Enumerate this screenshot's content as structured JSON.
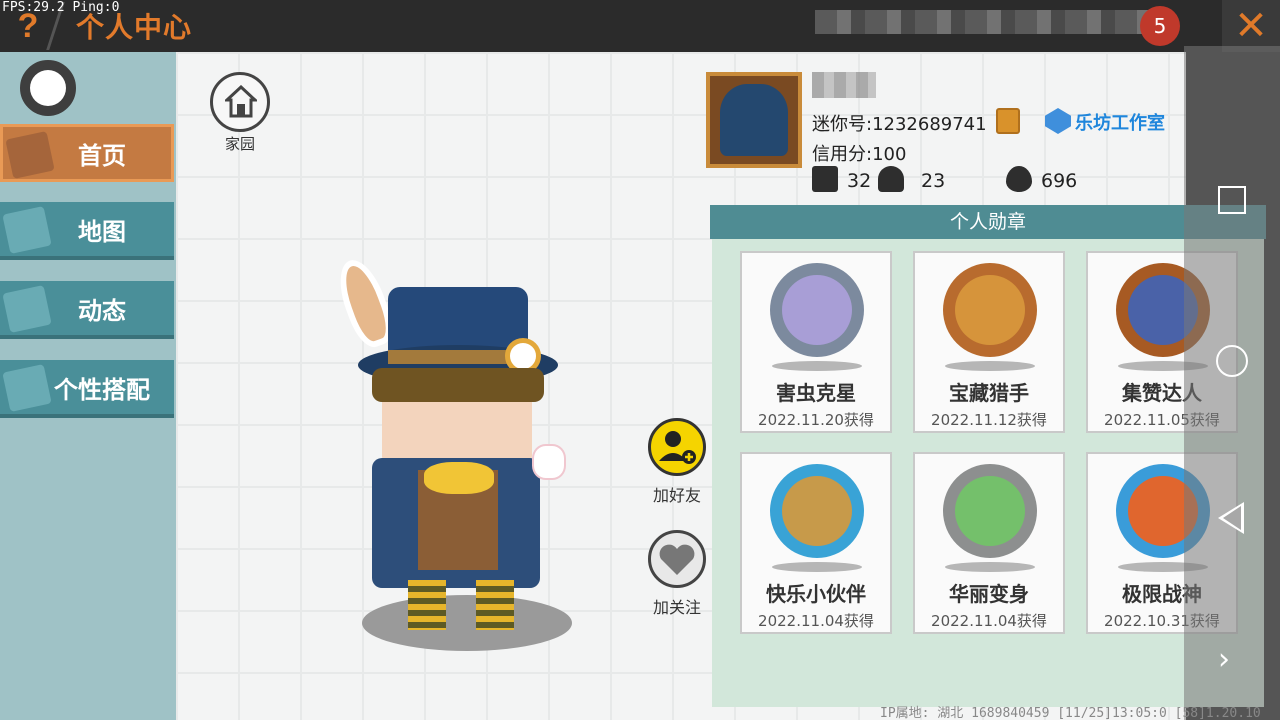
{
  "debug": {
    "fps": "FPS:29.2  Ping:0"
  },
  "header": {
    "help": "?",
    "title": "个人中心",
    "level": "5",
    "close": "✕"
  },
  "sidebar": {
    "items": [
      {
        "label": "首页",
        "icon": "shirt-icon",
        "active": true
      },
      {
        "label": "地图",
        "icon": "map-icon"
      },
      {
        "label": "动态",
        "icon": "bell-icon"
      },
      {
        "label": "个性搭配",
        "icon": "outfit-icon"
      }
    ]
  },
  "home": {
    "label": "家园",
    "icon": "home-icon"
  },
  "actions": {
    "add_friend": "加好友",
    "follow": "加关注"
  },
  "profile": {
    "mini_id": "迷你号:1232689741",
    "credit": "信用分:100",
    "studio": "乐坊工作室",
    "stats": [
      {
        "icon": "add-square-icon",
        "value": "32"
      },
      {
        "icon": "fans-icon",
        "value": "23"
      },
      {
        "icon": "flame-icon",
        "value": "696"
      }
    ]
  },
  "medals": {
    "title": "个人勋章",
    "items": [
      {
        "name": "害虫克星",
        "date": "2022.11.20获得",
        "ring": "#7c8a9e",
        "inner": "#a89ed6"
      },
      {
        "name": "宝藏猎手",
        "date": "2022.11.12获得",
        "ring": "#b86b2e",
        "inner": "#d6943b"
      },
      {
        "name": "集赞达人",
        "date": "2022.11.05获得",
        "ring": "#a75a23",
        "inner": "#4a62a8"
      },
      {
        "name": "快乐小伙伴",
        "date": "2022.11.04获得",
        "ring": "#39a3d6",
        "inner": "#c79a4a"
      },
      {
        "name": "华丽变身",
        "date": "2022.11.04获得",
        "ring": "#8d8f8f",
        "inner": "#74c06b"
      },
      {
        "name": "极限战神",
        "date": "2022.10.31获得",
        "ring": "#3a9cd9",
        "inner": "#e0662e"
      }
    ]
  },
  "footer": {
    "text": "IP属地: 湖北    1689840459   [11/25]13:05:0  [58]1.20.10"
  },
  "colors": {
    "accent": "#e27a2b",
    "nav": "#4a8f99",
    "panel": "#d2e7da"
  }
}
